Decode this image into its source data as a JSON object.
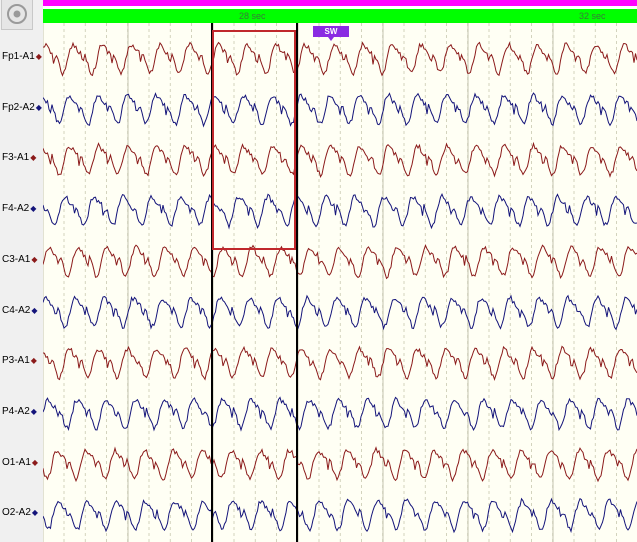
{
  "toolbar": {
    "settings_icon": "target-icon"
  },
  "timeline": {
    "labels": [
      {
        "text": "28 sec",
        "sec": 28
      },
      {
        "text": "32 sec",
        "sec": 32
      }
    ]
  },
  "channels": [
    {
      "label": "Fp1-A1",
      "marker": "◆",
      "color": "#8b1a1a"
    },
    {
      "label": "Fp2-A2",
      "marker": "◆",
      "color": "#14147a"
    },
    {
      "label": "F3-A1",
      "marker": "◆",
      "color": "#8b1a1a"
    },
    {
      "label": "F4-A2",
      "marker": "◆",
      "color": "#14147a"
    },
    {
      "label": "C3-A1",
      "marker": "◆",
      "color": "#8b1a1a"
    },
    {
      "label": "C4-A2",
      "marker": "◆",
      "color": "#14147a"
    },
    {
      "label": "P3-A1",
      "marker": "◆",
      "color": "#8b1a1a"
    },
    {
      "label": "P4-A2",
      "marker": "◆",
      "color": "#14147a"
    },
    {
      "label": "O1-A1",
      "marker": "◆",
      "color": "#8b1a1a"
    },
    {
      "label": "O2-A2",
      "marker": "◆",
      "color": "#14147a"
    }
  ],
  "event_marker": {
    "label": "SW",
    "color": "#8a2be2"
  },
  "colors": {
    "time_bar": "#00ff00",
    "top_stripe": "#ff00ff",
    "selection_box": "#c0282c",
    "cursor_lines": "#000000",
    "background": "#fffff4"
  }
}
